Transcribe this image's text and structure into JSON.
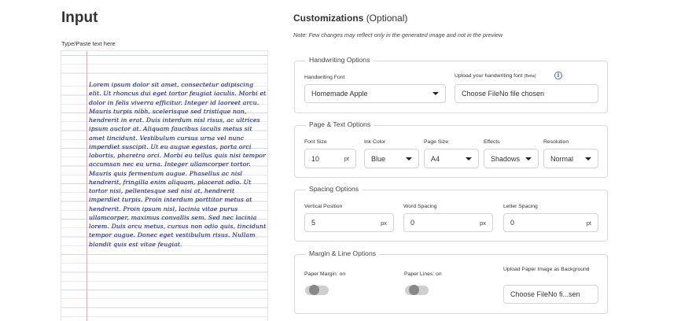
{
  "input": {
    "title": "Input",
    "subtitle": "Type/Paste text here",
    "text": "Lorem ipsum dolor sit amet, consectetur adipiscing elit. Ut rhoncus dui eget tortor feugiat iaculis. Morbi et dolor in felis viverra efficitur. Integer id laoreet arcu. Mauris turpis nibh, scelerisque sed tristique non, hendrerit in erat. Duis interdum nisl risus, ac ultrices ipsum auctor at. Aliquam faucibus iaculis metus sit amet tincidunt. Vestibulum cursus urna vel nunc imperdiet suscipit. Ut eu augue egestas, porta orci lobortis, pharetra orci. Morbi eu tellus quis nisi tempor accumsan nec eu urna. Integer ullamcorper tortor. Mauris quis fermentum augue. Phasellus ac nisl hendrerit, fringilla enim aliquam, placerat odio. Ut tortor nisi, pellentesque sed nisi at, hendrerit imperdiet turpis. Proin interdum porttitor metus at hendrerit. Proin ipsum nisl, lacinia vitae purus ullamcorper, maximus convallis sem. Sed nec lacinia lorem. Duis arcu metus, cursus non odio quis, tincidunt tempor augue. Donec eget vestibulum risus. Nullam blandit quis est vitae feugiat."
  },
  "customizations": {
    "title": "Customizations",
    "optional": "(Optional)",
    "note": "Note: Few changes may reflect only in the generated image and not in the preview"
  },
  "handwriting": {
    "legend": "Handwriting Options",
    "font_label": "Handwriting Font",
    "font_value": "Homemade Apple",
    "upload_label": "Upload your handwriting font",
    "upload_beta": "(Beta)",
    "upload_value": "Choose FileNo file chosen"
  },
  "page_text": {
    "legend": "Page & Text Options",
    "font_size_label": "Font Size",
    "font_size_value": "10",
    "font_size_unit": "pt",
    "ink_label": "Ink Color",
    "ink_value": "Blue",
    "page_size_label": "Page Size",
    "page_size_value": "A4",
    "effects_label": "Effects",
    "effects_value": "Shadows",
    "resolution_label": "Resolution",
    "resolution_value": "Normal"
  },
  "spacing": {
    "legend": "Spacing Options",
    "vertical_label": "Vertical Position",
    "vertical_value": "5",
    "vertical_unit": "px",
    "word_label": "Word Spacing",
    "word_value": "0",
    "word_unit": "px",
    "letter_label": "Letter Spacing",
    "letter_value": "0",
    "letter_unit": "pt"
  },
  "margin_line": {
    "legend": "Margin & Line Options",
    "margin_label": "Paper Margin: on",
    "lines_label": "Paper Lines: on",
    "upload_label": "Upload Paper Image as Background",
    "upload_value": "Choose FileNo fi...sen"
  },
  "colors": {
    "accent": "#3b6fd6",
    "ink": "#1c2778",
    "margin_line": "#f3aab0",
    "ruled_line": "#d2d6ec"
  },
  "icons": {
    "info": "info-circle-icon",
    "dropdown": "caret-down-icon"
  }
}
